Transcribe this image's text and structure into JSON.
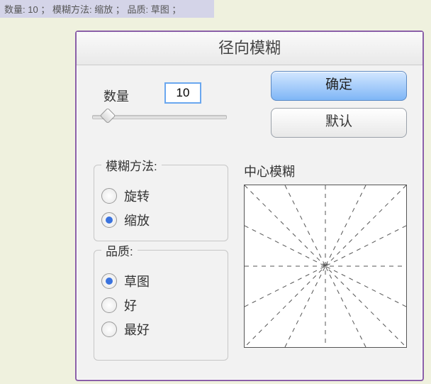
{
  "topbar": {
    "amount_k": "数量:",
    "amount_v": "10",
    "sep1": "；",
    "method_k": " 模糊方法:",
    "method_v": "缩放",
    "sep2": "；",
    "quality_k": " 品质:",
    "quality_v": "草图",
    "sep3": "；"
  },
  "dialog": {
    "title": "径向模糊",
    "amount_label": "数量",
    "amount_value": "10",
    "ok": "确定",
    "default": "默认",
    "method": {
      "legend": "模糊方法:",
      "options": [
        "旋转",
        "缩放"
      ],
      "selected": "缩放"
    },
    "quality": {
      "legend": "品质:",
      "options": [
        "草图",
        "好",
        "最好"
      ],
      "selected": "草图"
    },
    "center_label": "中心模糊"
  }
}
